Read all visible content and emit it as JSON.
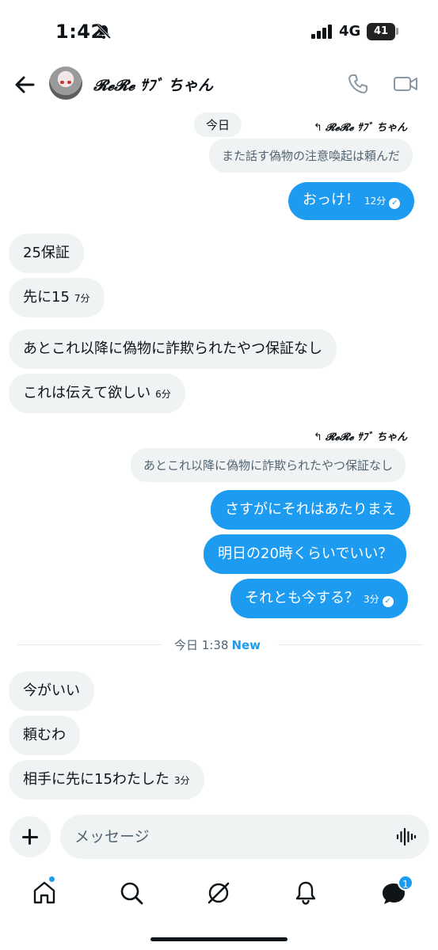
{
  "status_bar": {
    "time": "1:42",
    "network": "4G",
    "battery": "41"
  },
  "header": {
    "contact_name": "𝓡𝓮𝓡𝓮 ｻﾌﾞ ちゃん"
  },
  "today_chip": "今日",
  "messages": [
    {
      "reply_label": "𝓡𝓮𝓡𝓮 ｻﾌﾞ ちゃん",
      "quote": "また話す偽物の注意喚起は頼んだ"
    },
    {
      "text": "おっけ！",
      "time": "12分"
    },
    {
      "text": "25保証"
    },
    {
      "text": "先に15",
      "time": "7分"
    },
    {
      "text": "あとこれ以降に偽物に詐欺られたやつ保証なし"
    },
    {
      "text": "これは伝えて欲しい",
      "time": "6分"
    },
    {
      "reply_label": "𝓡𝓮𝓡𝓮 ｻﾌﾞ ちゃん",
      "quote": "あとこれ以降に偽物に詐欺られたやつ保証なし"
    },
    {
      "text": "さすがにそれはあたりまえ"
    },
    {
      "text": "明日の20時くらいでいい？"
    },
    {
      "text": "それとも今する？",
      "time": "3分"
    },
    {
      "text": "今がいい"
    },
    {
      "text": "頼むわ"
    },
    {
      "text": "相手に先に15わたした",
      "time": "3分"
    }
  ],
  "divider": {
    "text": "今日 1:38",
    "new_label": "New"
  },
  "composer": {
    "placeholder": "メッセージ"
  },
  "nav": {
    "messages_badge": "1"
  },
  "colors": {
    "accent": "#1d9bf0",
    "incoming_bubble": "#eff3f4",
    "text": "#0f1419",
    "muted": "#536471"
  },
  "icons": [
    "back-arrow-icon",
    "phone-icon",
    "video-icon",
    "plus-icon",
    "voice-icon",
    "home-icon",
    "search-icon",
    "grok-icon",
    "bell-icon",
    "mail-icon"
  ]
}
